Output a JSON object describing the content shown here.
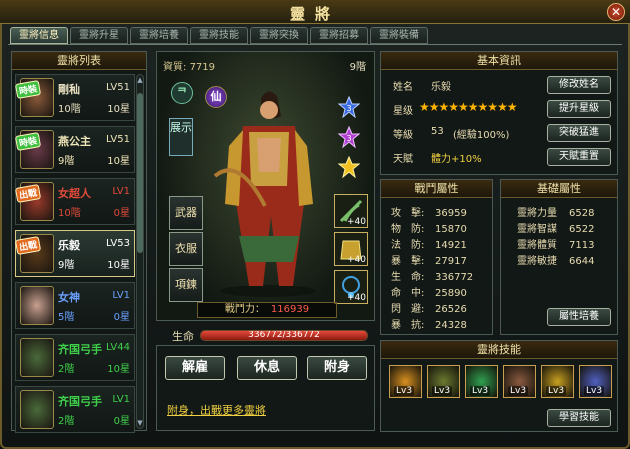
{
  "window": {
    "title": "靈將",
    "close_icon": "close-icon"
  },
  "tabs": [
    "靈將信息",
    "靈將升星",
    "靈將培養",
    "靈將技能",
    "靈將突換",
    "靈將招募",
    "靈將裝備"
  ],
  "list": {
    "title": "靈將列表",
    "items": [
      {
        "badge": "時裝",
        "badge_color": "#3fbf3f",
        "name": "剛秈",
        "level": "LV51",
        "rank": "10階",
        "stars": "10星",
        "name_color": "#e8e0c0",
        "portrait": "#8a5a3a"
      },
      {
        "badge": "時裝",
        "badge_color": "#3fbf3f",
        "name": "燕公主",
        "level": "LV51",
        "rank": "9階",
        "stars": "10星",
        "name_color": "#f0e6b8",
        "portrait": "#6a3a4a"
      },
      {
        "badge": "出戰",
        "badge_color": "#e06a20",
        "name": "女超人",
        "level": "LV1",
        "rank": "10階",
        "stars": "0星",
        "name_color": "#e04a3a",
        "portrait": "#9a3a2a"
      },
      {
        "badge": "出戰",
        "badge_color": "#e06a20",
        "name": "乐毅",
        "level": "LV53",
        "rank": "9階",
        "stars": "10星",
        "name_color": "#ffffff",
        "portrait": "#5a3a1a"
      },
      {
        "badge": "",
        "badge_color": "",
        "name": "女神",
        "level": "LV1",
        "rank": "5階",
        "stars": "0星",
        "name_color": "#6aa0ff",
        "portrait": "#c8a090"
      },
      {
        "badge": "",
        "badge_color": "",
        "name": "齐国弓手",
        "level": "LV44",
        "rank": "2階",
        "stars": "10星",
        "name_color": "#3fd04a",
        "portrait": "#4a6a3a"
      },
      {
        "badge": "",
        "badge_color": "",
        "name": "齐国弓手",
        "level": "LV1",
        "rank": "2階",
        "stars": "0星",
        "name_color": "#3fd04a",
        "portrait": "#4a6a3a"
      }
    ]
  },
  "center": {
    "aptitude_label": "資質:",
    "aptitude_value": "7719",
    "rank": "9階",
    "xian": "仙",
    "show_label": "展示",
    "slots": [
      "武器",
      "衣服",
      "項鍊"
    ],
    "gem_levels": [
      "3",
      "3",
      ""
    ],
    "equip_plus": [
      "+40",
      "+40",
      "+40"
    ],
    "power_label": "戰鬥力：",
    "power_value": "116939"
  },
  "hp": {
    "label": "生命",
    "text": "336772/336772",
    "fraction": 1.0
  },
  "actions": {
    "dismiss": "解雇",
    "rest": "休息",
    "attach": "附身",
    "link": "附身，出戰更多靈將"
  },
  "basic": {
    "title": "基本資訊",
    "name_label": "姓名",
    "name_value": "乐毅",
    "star_label": "星级",
    "stars": "★★★★★★★★★★",
    "level_label": "等級",
    "level_value": "53",
    "exp": "(經驗100%)",
    "talent_label": "天賦",
    "talent_value": "體力+10%",
    "btn_rename": "修改姓名",
    "btn_upstar": "提升星級",
    "btn_break": "突破猛進",
    "btn_reset": "天賦重置"
  },
  "fight_attrs": {
    "title": "戰鬥屬性",
    "rows": [
      [
        "攻　擊:",
        "36959"
      ],
      [
        "物　防:",
        "15870"
      ],
      [
        "法　防:",
        "14921"
      ],
      [
        "暴　擊:",
        "27917"
      ],
      [
        "生　命:",
        "336772"
      ],
      [
        "命　中:",
        "25890"
      ],
      [
        "閃　避:",
        "26526"
      ],
      [
        "暴　抗:",
        "24328"
      ]
    ]
  },
  "base_attrs": {
    "title": "基礎屬性",
    "rows": [
      [
        "靈將力量",
        "6528"
      ],
      [
        "靈將智謀",
        "6522"
      ],
      [
        "靈將體質",
        "7113"
      ],
      [
        "靈將敏捷",
        "6644"
      ]
    ],
    "btn_train": "屬性培養"
  },
  "skills": {
    "title": "靈將技能",
    "items": [
      {
        "lv": "Lv3",
        "color": "#d89020"
      },
      {
        "lv": "Lv3",
        "color": "#6a7a30"
      },
      {
        "lv": "Lv3",
        "color": "#30a050"
      },
      {
        "lv": "Lv3",
        "color": "#8a5a40"
      },
      {
        "lv": "Lv3",
        "color": "#c8a020"
      },
      {
        "lv": "Lv3",
        "color": "#5060c0"
      }
    ],
    "btn_learn": "學習技能"
  }
}
